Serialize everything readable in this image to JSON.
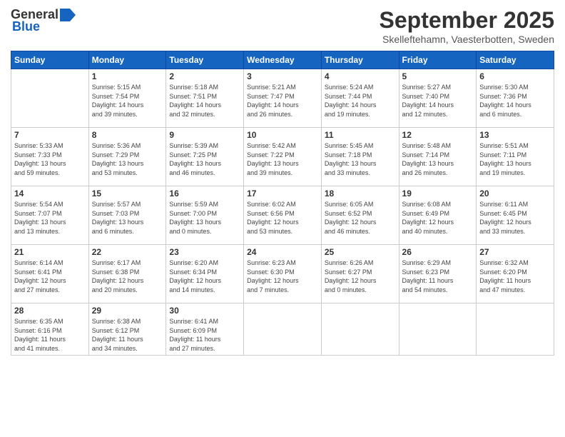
{
  "header": {
    "logo_general": "General",
    "logo_blue": "Blue",
    "month": "September 2025",
    "location": "Skelleftehamn, Vaesterbotten, Sweden"
  },
  "days_of_week": [
    "Sunday",
    "Monday",
    "Tuesday",
    "Wednesday",
    "Thursday",
    "Friday",
    "Saturday"
  ],
  "weeks": [
    [
      {
        "day": "",
        "info": ""
      },
      {
        "day": "1",
        "info": "Sunrise: 5:15 AM\nSunset: 7:54 PM\nDaylight: 14 hours\nand 39 minutes."
      },
      {
        "day": "2",
        "info": "Sunrise: 5:18 AM\nSunset: 7:51 PM\nDaylight: 14 hours\nand 32 minutes."
      },
      {
        "day": "3",
        "info": "Sunrise: 5:21 AM\nSunset: 7:47 PM\nDaylight: 14 hours\nand 26 minutes."
      },
      {
        "day": "4",
        "info": "Sunrise: 5:24 AM\nSunset: 7:44 PM\nDaylight: 14 hours\nand 19 minutes."
      },
      {
        "day": "5",
        "info": "Sunrise: 5:27 AM\nSunset: 7:40 PM\nDaylight: 14 hours\nand 12 minutes."
      },
      {
        "day": "6",
        "info": "Sunrise: 5:30 AM\nSunset: 7:36 PM\nDaylight: 14 hours\nand 6 minutes."
      }
    ],
    [
      {
        "day": "7",
        "info": "Sunrise: 5:33 AM\nSunset: 7:33 PM\nDaylight: 13 hours\nand 59 minutes."
      },
      {
        "day": "8",
        "info": "Sunrise: 5:36 AM\nSunset: 7:29 PM\nDaylight: 13 hours\nand 53 minutes."
      },
      {
        "day": "9",
        "info": "Sunrise: 5:39 AM\nSunset: 7:25 PM\nDaylight: 13 hours\nand 46 minutes."
      },
      {
        "day": "10",
        "info": "Sunrise: 5:42 AM\nSunset: 7:22 PM\nDaylight: 13 hours\nand 39 minutes."
      },
      {
        "day": "11",
        "info": "Sunrise: 5:45 AM\nSunset: 7:18 PM\nDaylight: 13 hours\nand 33 minutes."
      },
      {
        "day": "12",
        "info": "Sunrise: 5:48 AM\nSunset: 7:14 PM\nDaylight: 13 hours\nand 26 minutes."
      },
      {
        "day": "13",
        "info": "Sunrise: 5:51 AM\nSunset: 7:11 PM\nDaylight: 13 hours\nand 19 minutes."
      }
    ],
    [
      {
        "day": "14",
        "info": "Sunrise: 5:54 AM\nSunset: 7:07 PM\nDaylight: 13 hours\nand 13 minutes."
      },
      {
        "day": "15",
        "info": "Sunrise: 5:57 AM\nSunset: 7:03 PM\nDaylight: 13 hours\nand 6 minutes."
      },
      {
        "day": "16",
        "info": "Sunrise: 5:59 AM\nSunset: 7:00 PM\nDaylight: 13 hours\nand 0 minutes."
      },
      {
        "day": "17",
        "info": "Sunrise: 6:02 AM\nSunset: 6:56 PM\nDaylight: 12 hours\nand 53 minutes."
      },
      {
        "day": "18",
        "info": "Sunrise: 6:05 AM\nSunset: 6:52 PM\nDaylight: 12 hours\nand 46 minutes."
      },
      {
        "day": "19",
        "info": "Sunrise: 6:08 AM\nSunset: 6:49 PM\nDaylight: 12 hours\nand 40 minutes."
      },
      {
        "day": "20",
        "info": "Sunrise: 6:11 AM\nSunset: 6:45 PM\nDaylight: 12 hours\nand 33 minutes."
      }
    ],
    [
      {
        "day": "21",
        "info": "Sunrise: 6:14 AM\nSunset: 6:41 PM\nDaylight: 12 hours\nand 27 minutes."
      },
      {
        "day": "22",
        "info": "Sunrise: 6:17 AM\nSunset: 6:38 PM\nDaylight: 12 hours\nand 20 minutes."
      },
      {
        "day": "23",
        "info": "Sunrise: 6:20 AM\nSunset: 6:34 PM\nDaylight: 12 hours\nand 14 minutes."
      },
      {
        "day": "24",
        "info": "Sunrise: 6:23 AM\nSunset: 6:30 PM\nDaylight: 12 hours\nand 7 minutes."
      },
      {
        "day": "25",
        "info": "Sunrise: 6:26 AM\nSunset: 6:27 PM\nDaylight: 12 hours\nand 0 minutes."
      },
      {
        "day": "26",
        "info": "Sunrise: 6:29 AM\nSunset: 6:23 PM\nDaylight: 11 hours\nand 54 minutes."
      },
      {
        "day": "27",
        "info": "Sunrise: 6:32 AM\nSunset: 6:20 PM\nDaylight: 11 hours\nand 47 minutes."
      }
    ],
    [
      {
        "day": "28",
        "info": "Sunrise: 6:35 AM\nSunset: 6:16 PM\nDaylight: 11 hours\nand 41 minutes."
      },
      {
        "day": "29",
        "info": "Sunrise: 6:38 AM\nSunset: 6:12 PM\nDaylight: 11 hours\nand 34 minutes."
      },
      {
        "day": "30",
        "info": "Sunrise: 6:41 AM\nSunset: 6:09 PM\nDaylight: 11 hours\nand 27 minutes."
      },
      {
        "day": "",
        "info": ""
      },
      {
        "day": "",
        "info": ""
      },
      {
        "day": "",
        "info": ""
      },
      {
        "day": "",
        "info": ""
      }
    ]
  ]
}
